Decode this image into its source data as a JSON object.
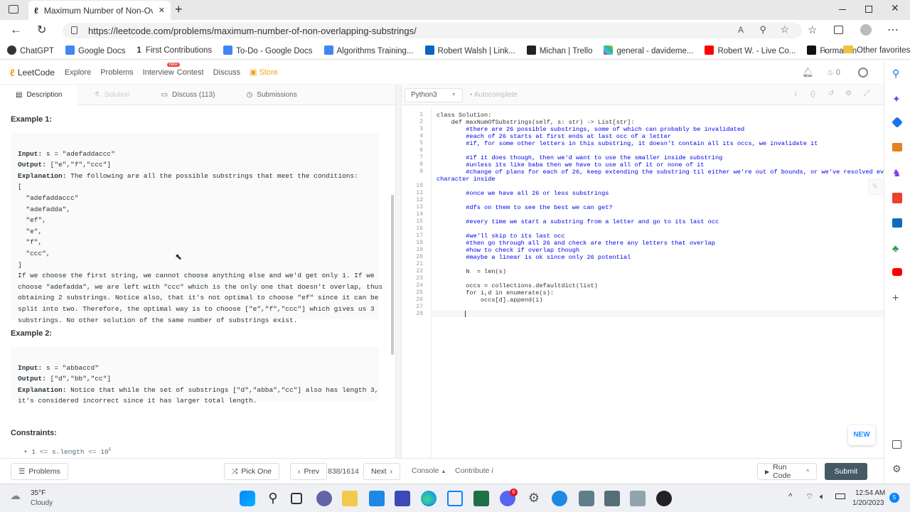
{
  "browser": {
    "tab_title": "Maximum Number of Non-Overl",
    "tab_close": "✕",
    "new_tab": "+",
    "url": "https://leetcode.com/problems/maximum-number-of-non-overlapping-substrings/",
    "bookmarks": [
      "ChatGPT",
      "Google Docs",
      "First Contributions",
      "To-Do - Google Docs",
      "Algorithms Training...",
      "Robert Walsh | Link...",
      "Michan | Trello",
      "general - davideme...",
      "Robert W. - Live Co...",
      "Formation"
    ],
    "other_favorites": "Other favorites"
  },
  "nav": {
    "logo": "LeetCode",
    "items": [
      "Explore",
      "Problems",
      "Interview",
      "Contest",
      "Discuss",
      "Store"
    ],
    "new_badge": "New",
    "points": "0"
  },
  "tabs": {
    "description": "Description",
    "solution": "Solution",
    "discuss": "Discuss (113)",
    "submissions": "Submissions"
  },
  "problem": {
    "example1_title": "Example 1:",
    "example1_lines": [
      "Input: s = \"adefaddaccc\"",
      "Output: [\"e\",\"f\",\"ccc\"]",
      "Explanation: The following are all the possible substrings that meet the conditions:",
      "[",
      "  \"adefaddaccc\"",
      "  \"adefadda\",",
      "  \"ef\",",
      "  \"e\",",
      "  \"f\",",
      "  \"ccc\",",
      "]",
      "If we choose the first string, we cannot choose anything else and we'd get only 1. If we",
      "choose \"adefadda\", we are left with \"ccc\" which is the only one that doesn't overlap, thus",
      "obtaining 2 substrings. Notice also, that it's not optimal to choose \"ef\" since it can be",
      "split into two. Therefore, the optimal way is to choose [\"e\",\"f\",\"ccc\"] which gives us 3",
      "substrings. No other solution of the same number of substrings exist."
    ],
    "example2_title": "Example 2:",
    "example2_lines": [
      "Input: s = \"abbaccd\"",
      "Output: [\"d\",\"bb\",\"cc\"]",
      "Explanation: Notice that while the set of substrings [\"d\",\"abba\",\"cc\"] also has length 3,",
      "it's considered incorrect since it has larger total length."
    ],
    "constraints_title": "Constraints:",
    "constraint1": "1 <= s.length <= 10"
  },
  "editor": {
    "language": "Python3",
    "autocomplete": "Autocomplete",
    "lines": [
      "class Solution:",
      "    def maxNumOfSubstrings(self, s: str) -> List[str]:",
      "        #there are 26 possible substrings, some of which can probably be invalidated",
      "        #each of 26 starts at first ends at last occ of a letter",
      "        #if, for some other letters in this substring, it doesn't contain all its occs, we invalidate it",
      "",
      "        #if it does though, then we'd want to use the smaller inside substring",
      "        #unless its like baba then we have to use all of it or none of it",
      "        #change of plans for each of 26, keep extending the substring til either we're out of bounds, or we've resolved every",
      "character inside",
      "",
      "        #once we have all 26 or less substrings",
      "",
      "        #dfs on them to see the best we can get?",
      "",
      "        #every time we start a substring from a letter and go to its last occ",
      "",
      "        #we'll skip to its last occ",
      "        #then go through all 26 and check are there any letters that overlap",
      "        #how to check if overlap though",
      "        #maybe a linear is ok since only 26 potential",
      "",
      "        N  = len(s)",
      "",
      "        occs = collections.defaultdict(list)",
      "        for i,d in enumerate(s):",
      "            occs[d].append(i)",
      "",
      ""
    ],
    "line_numbers": [
      "1",
      "2",
      "3",
      "4",
      "5",
      "6",
      "7",
      "8",
      "9",
      "",
      "10",
      "11",
      "12",
      "13",
      "14",
      "15",
      "16",
      "17",
      "18",
      "19",
      "20",
      "21",
      "22",
      "23",
      "24",
      "25",
      "26",
      "27",
      "28"
    ]
  },
  "footer": {
    "problems": "Problems",
    "pick_one": "Pick One",
    "prev": "Prev",
    "counter": "838/1614",
    "next": "Next",
    "console": "Console",
    "contribute": "Contribute",
    "run": "Run Code",
    "submit": "Submit",
    "new_badge": "NEW"
  },
  "taskbar": {
    "temp": "35°F",
    "weather": "Cloudy",
    "time": "12:54 AM",
    "date": "1/20/2023",
    "notif": "5",
    "discord_badge": "6"
  }
}
